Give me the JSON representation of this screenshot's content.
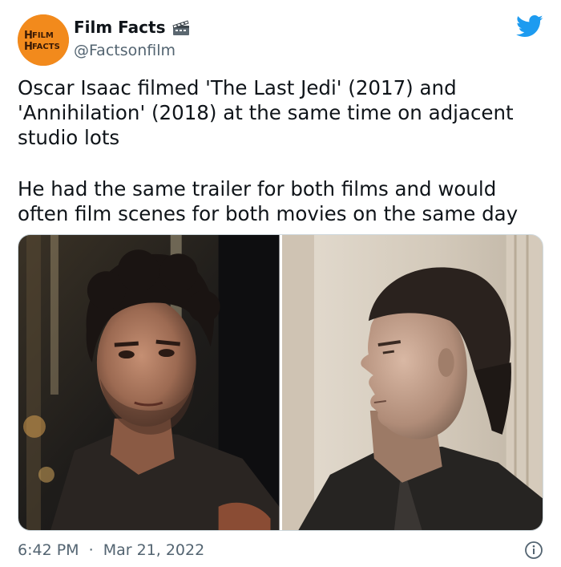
{
  "author": {
    "name": "Film Facts",
    "handle": "@Factsonfilm",
    "avatar_text": "FILM FACTS",
    "avatar_color": "#f7931e"
  },
  "icons": {
    "badge": "clapperboard-icon",
    "brand": "twitter-bird-icon",
    "info": "info-icon"
  },
  "tweet": {
    "paragraph_1": "Oscar Isaac filmed 'The Last Jedi' (2017) and\n'Annihilation' (2018) at the same time on adjacent\nstudio lots",
    "paragraph_2": "He had the same trailer for both films and would\noften film scenes for both movies on the same day",
    "time": "6:42 PM",
    "separator": "·",
    "date": "Mar 21, 2022"
  },
  "media": {
    "photo_count": 2
  },
  "colors": {
    "brand_blue": "#1d9bf0",
    "text_primary": "#0f1419",
    "text_secondary": "#536471"
  }
}
